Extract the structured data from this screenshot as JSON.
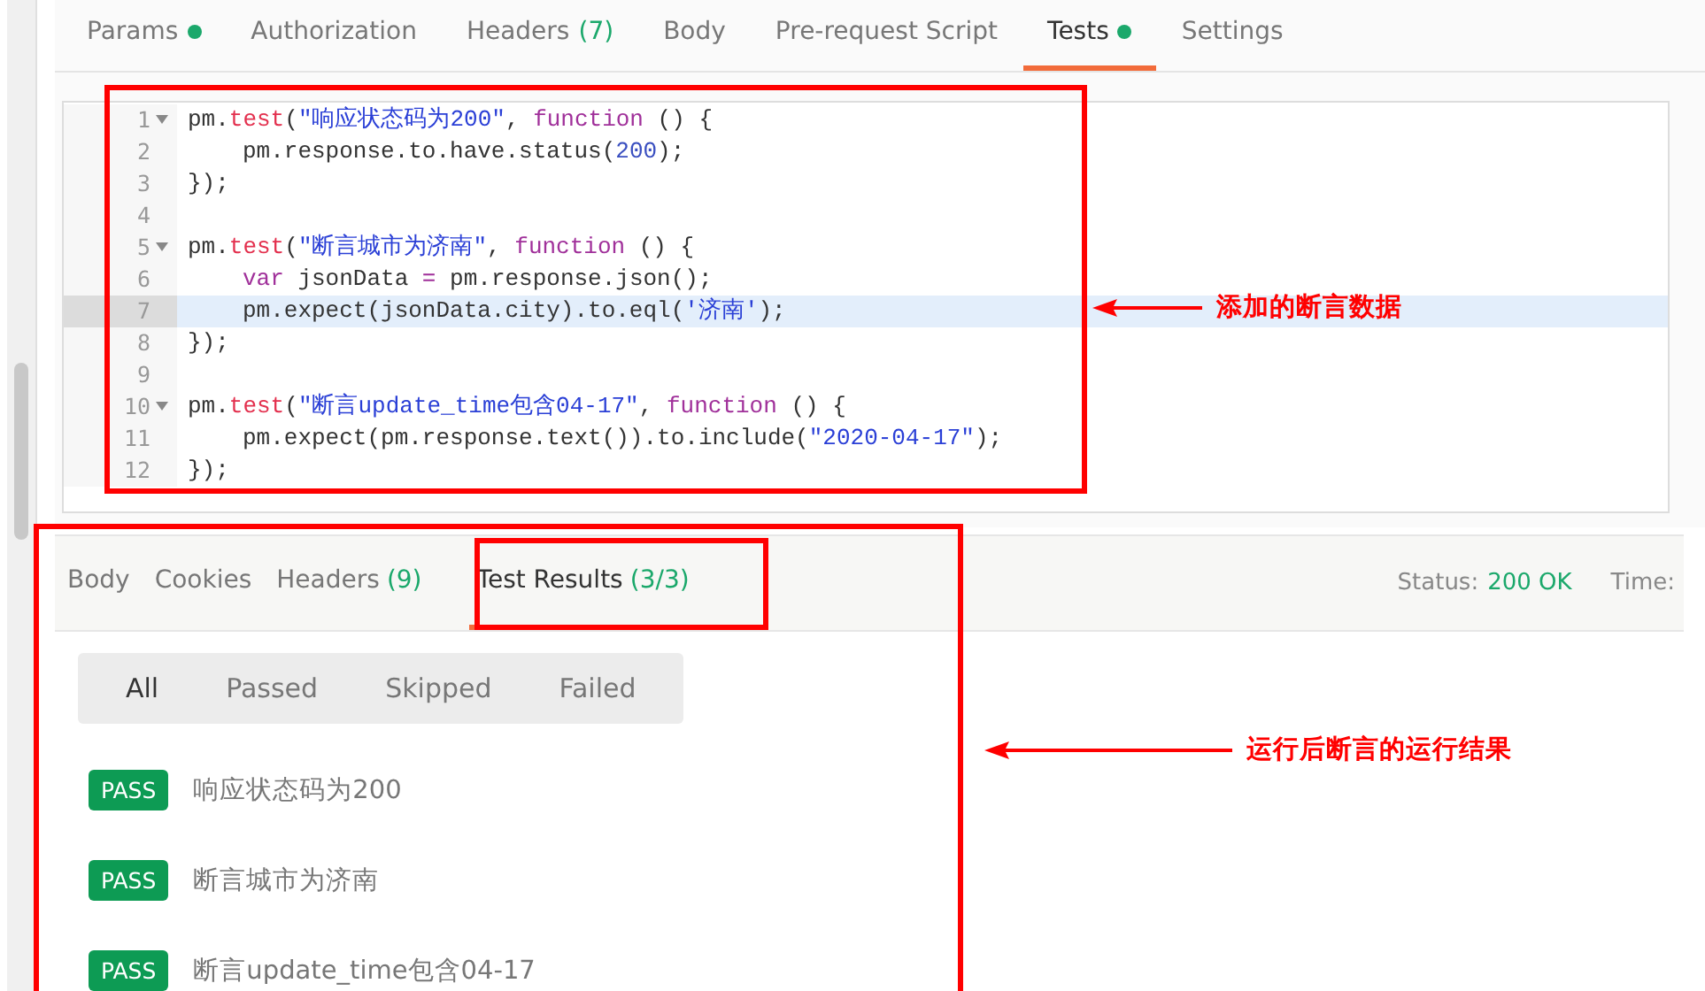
{
  "request_tabs": [
    {
      "label": "Params",
      "dot": true,
      "selected": false
    },
    {
      "label": "Authorization",
      "dot": false,
      "selected": false
    },
    {
      "label": "Headers",
      "count": "(7)",
      "dot": false,
      "selected": false
    },
    {
      "label": "Body",
      "dot": false,
      "selected": false
    },
    {
      "label": "Pre-request Script",
      "dot": false,
      "selected": false
    },
    {
      "label": "Tests",
      "dot": true,
      "selected": true
    },
    {
      "label": "Settings",
      "dot": false,
      "selected": false
    }
  ],
  "editor": {
    "lines": [
      {
        "number": "1",
        "fold": true,
        "indented": false,
        "highlighted": false,
        "tokens": [
          {
            "kind": "plain",
            "t": "pm."
          },
          {
            "kind": "method",
            "t": "test"
          },
          {
            "kind": "plain",
            "t": "("
          },
          {
            "kind": "string",
            "t": "\"响应状态码为200\""
          },
          {
            "kind": "plain",
            "t": ", "
          },
          {
            "kind": "keyword",
            "t": "function"
          },
          {
            "kind": "plain",
            "t": " () {"
          }
        ]
      },
      {
        "number": "2",
        "fold": false,
        "indented": true,
        "highlighted": false,
        "tokens": [
          {
            "kind": "plain",
            "t": "pm.response.to.have.status("
          },
          {
            "kind": "number",
            "t": "200"
          },
          {
            "kind": "plain",
            "t": ");"
          }
        ]
      },
      {
        "number": "3",
        "fold": false,
        "indented": false,
        "highlighted": false,
        "tokens": [
          {
            "kind": "plain",
            "t": "});"
          }
        ]
      },
      {
        "number": "4",
        "fold": false,
        "highlighted": false
      },
      {
        "number": "5",
        "fold": true,
        "indented": false,
        "highlighted": false,
        "tokens": [
          {
            "kind": "plain",
            "t": "pm."
          },
          {
            "kind": "method",
            "t": "test"
          },
          {
            "kind": "plain",
            "t": "("
          },
          {
            "kind": "string",
            "t": "\"断言城市为济南\""
          },
          {
            "kind": "plain",
            "t": ", "
          },
          {
            "kind": "keyword",
            "t": "function"
          },
          {
            "kind": "plain",
            "t": " () {"
          }
        ]
      },
      {
        "number": "6",
        "fold": false,
        "indented": true,
        "highlighted": false,
        "tokens": [
          {
            "kind": "keyword",
            "t": "var"
          },
          {
            "kind": "plain",
            "t": " jsonData "
          },
          {
            "kind": "keyword",
            "t": "="
          },
          {
            "kind": "plain",
            "t": " pm.response.json();"
          }
        ]
      },
      {
        "number": "7",
        "fold": false,
        "indented": true,
        "highlighted": true,
        "tokens": [
          {
            "kind": "plain",
            "t": "pm.expect(jsonData.city).to.eql("
          },
          {
            "kind": "string",
            "t": "'济南'"
          },
          {
            "kind": "plain",
            "t": ");"
          }
        ]
      },
      {
        "number": "8",
        "fold": false,
        "indented": false,
        "highlighted": false,
        "tokens": [
          {
            "kind": "plain",
            "t": "});"
          }
        ]
      },
      {
        "number": "9",
        "fold": false,
        "highlighted": false
      },
      {
        "number": "10",
        "fold": true,
        "indented": false,
        "highlighted": false,
        "tokens": [
          {
            "kind": "plain",
            "t": "pm."
          },
          {
            "kind": "method",
            "t": "test"
          },
          {
            "kind": "plain",
            "t": "("
          },
          {
            "kind": "string",
            "t": "\"断言update_time包含04-17\""
          },
          {
            "kind": "plain",
            "t": ", "
          },
          {
            "kind": "keyword",
            "t": "function"
          },
          {
            "kind": "plain",
            "t": " () {"
          }
        ]
      },
      {
        "number": "11",
        "fold": false,
        "indented": true,
        "highlighted": false,
        "tokens": [
          {
            "kind": "plain",
            "t": "pm.expect(pm.response.text()).to.include("
          },
          {
            "kind": "string",
            "t": "\"2020-04-17\""
          },
          {
            "kind": "plain",
            "t": ");"
          }
        ]
      },
      {
        "number": "12",
        "fold": false,
        "indented": false,
        "highlighted": false,
        "tokens": [
          {
            "kind": "plain",
            "t": "});"
          }
        ]
      }
    ]
  },
  "response_tabs": [
    {
      "label": "Body",
      "selected": false
    },
    {
      "label": "Cookies",
      "selected": false
    },
    {
      "label": "Headers",
      "count": "(9)",
      "selected": false
    },
    {
      "label": "Test Results",
      "count": "(3/3)",
      "selected": true
    }
  ],
  "status": {
    "label": "Status:",
    "value": "200 OK",
    "time_label": "Time:"
  },
  "filters": [
    {
      "label": "All",
      "selected": true
    },
    {
      "label": "Passed",
      "selected": false
    },
    {
      "label": "Skipped",
      "selected": false
    },
    {
      "label": "Failed",
      "selected": false
    }
  ],
  "results": [
    {
      "badge": "PASS",
      "name": "响应状态码为200"
    },
    {
      "badge": "PASS",
      "name": "断言城市为济南"
    },
    {
      "badge": "PASS",
      "name": "断言update_time包含04-17"
    }
  ],
  "annotations": [
    {
      "text": "添加的断言数据"
    },
    {
      "text": "运行后断言的运行结果"
    }
  ]
}
